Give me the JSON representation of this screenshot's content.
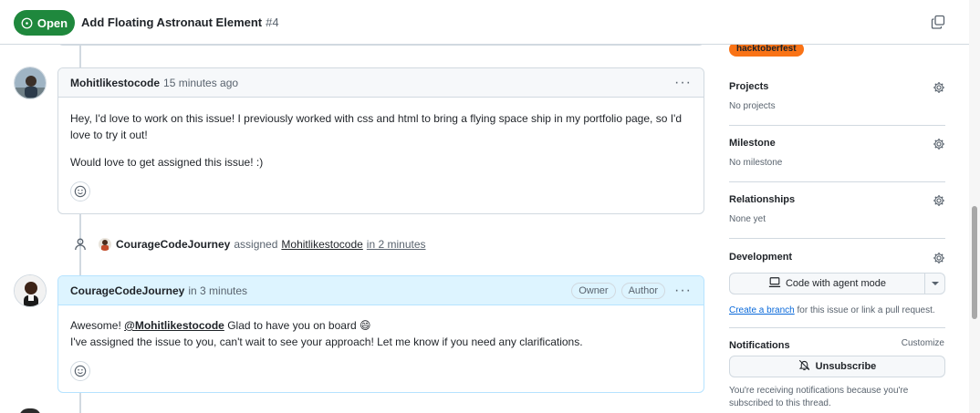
{
  "header": {
    "state": "Open",
    "title": "Add Floating Astronaut Element",
    "number": "#4"
  },
  "comments": [
    {
      "author": "Mohitlikestocode",
      "time": "15 minutes ago",
      "paragraphs": [
        "Hey, I'd love to work on this issue! I previously worked with css and html to bring a flying space ship in my portfolio page, so I'd love to try it out!",
        "Would love to get assigned this issue! :)"
      ]
    },
    {
      "author": "CourageCodeJourney",
      "time": "in 3 minutes",
      "badges": [
        "Owner",
        "Author"
      ],
      "mention": "@Mohitlikestocode",
      "line1_rest": " Glad to have you on board 😄",
      "line1_prefix": "Awesome! ",
      "line2": "I've assigned the issue to you, can't wait to see your approach! Let me know if you need any clarifications."
    }
  ],
  "event": {
    "actor": "CourageCodeJourney",
    "action": "assigned",
    "target": "Mohitlikestocode",
    "time": "in 2 minutes"
  },
  "sidebar": {
    "label": "hacktoberfest",
    "label_color": "#f97316",
    "projects": {
      "title": "Projects",
      "value": "No projects"
    },
    "milestone": {
      "title": "Milestone",
      "value": "No milestone"
    },
    "relationships": {
      "title": "Relationships",
      "value": "None yet"
    },
    "development": {
      "title": "Development",
      "button": "Code with agent mode",
      "link": "Create a branch",
      "link_rest": " for this issue or link a pull request."
    },
    "notifications": {
      "title": "Notifications",
      "customize": "Customize",
      "button": "Unsubscribe",
      "note": "You're receiving notifications because you're subscribed to this thread."
    }
  },
  "colors": {
    "open_green": "#1f883d",
    "owner_header": "#ddf4ff",
    "link_blue": "#0969da"
  },
  "icons": [
    "issue-open-icon",
    "copy-icon",
    "kebab-icon",
    "smiley-icon",
    "person-icon",
    "gear-icon",
    "agent-icon",
    "caret-down-icon",
    "bell-slash-icon"
  ]
}
